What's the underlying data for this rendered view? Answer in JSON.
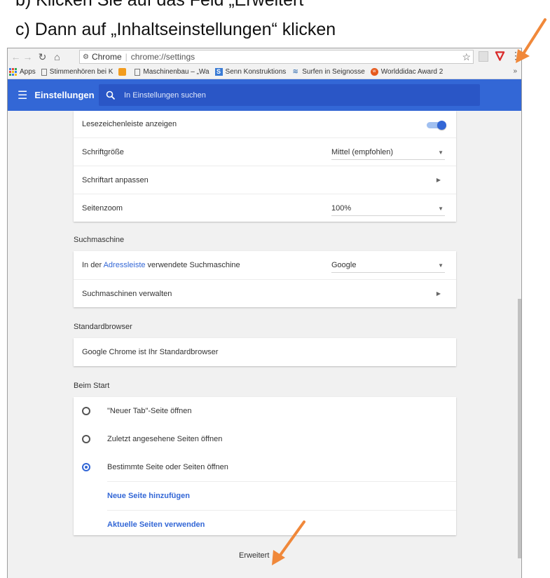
{
  "instructions": {
    "line_b": "b) Klicken Sie auf das Feld „Erweitert“",
    "line_c": "c) Dann auf „Inhaltseinstellungen“ klicken"
  },
  "omnibar": {
    "back_icon": "back-arrow-icon",
    "forward_icon": "forward-arrow-icon",
    "reload_icon": "reload-icon",
    "home_icon": "home-icon",
    "site_name": "Chrome",
    "url": "chrome://settings"
  },
  "bookmarks": [
    {
      "label": "Apps",
      "icon": "apps-grid-icon"
    },
    {
      "label": "Stimmenhören bei K",
      "icon": "page-icon"
    },
    {
      "label": "",
      "icon": "orange-app-icon"
    },
    {
      "label": "Maschinenbau – „Wa",
      "icon": "page-icon"
    },
    {
      "label": "Senn Konstruktions",
      "icon": "s-logo-icon"
    },
    {
      "label": "Surfen in Seignosse",
      "icon": "surf-icon"
    },
    {
      "label": "Worlddidac Award 2",
      "icon": "worlddidac-icon"
    }
  ],
  "bookmarks_more": "»",
  "appbar": {
    "title": "Einstellungen",
    "search_placeholder": "In Einstellungen suchen"
  },
  "appearance": {
    "bookmarks_bar_label": "Lesezeichenleiste anzeigen",
    "bookmarks_bar_enabled": true,
    "font_size_label": "Schriftgröße",
    "font_size_value": "Mittel (empfohlen)",
    "customize_fonts_label": "Schriftart anpassen",
    "page_zoom_label": "Seitenzoom",
    "page_zoom_value": "100%"
  },
  "search_engine": {
    "section_title": "Suchmaschine",
    "engine_label_prefix": "In der ",
    "engine_label_link": "Adressleiste",
    "engine_label_suffix": " verwendete Suchmaschine",
    "engine_value": "Google",
    "manage_label": "Suchmaschinen verwalten"
  },
  "default_browser": {
    "section_title": "Standardbrowser",
    "status": "Google Chrome ist Ihr Standardbrowser"
  },
  "on_startup": {
    "section_title": "Beim Start",
    "options": [
      {
        "label": "\"Neuer Tab\"-Seite öffnen",
        "checked": false
      },
      {
        "label": "Zuletzt angesehene Seiten öffnen",
        "checked": false
      },
      {
        "label": "Bestimmte Seite oder Seiten öffnen",
        "checked": true
      }
    ],
    "add_page": "Neue Seite hinzufügen",
    "use_current": "Aktuelle Seiten verwenden"
  },
  "advanced": {
    "label": "Erweitert"
  },
  "colors": {
    "appbar": "#3367d6",
    "accent": "#3367d6",
    "annotation_arrow": "#f0883a"
  }
}
